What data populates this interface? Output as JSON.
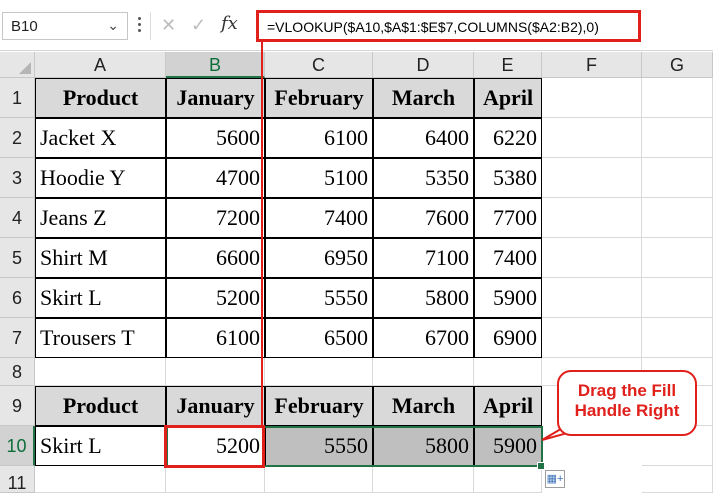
{
  "formula_bar": {
    "name_box": "B10",
    "formula": "=VLOOKUP($A10,$A$1:$E$7,COLUMNS($A2:B2),0)",
    "icons": [
      "chevron-down-icon",
      "more-icon",
      "cancel-icon",
      "enter-icon",
      "function-icon"
    ],
    "fx_label": "fx"
  },
  "columns": [
    "A",
    "B",
    "C",
    "D",
    "E",
    "F",
    "G"
  ],
  "rows": [
    "1",
    "2",
    "3",
    "4",
    "5",
    "6",
    "7",
    "8",
    "9",
    "10",
    "11"
  ],
  "table1": {
    "headers": [
      "Product",
      "January",
      "February",
      "March",
      "April"
    ],
    "rows": [
      [
        "Jacket X",
        "5600",
        "6100",
        "6400",
        "6220"
      ],
      [
        "Hoodie Y",
        "4700",
        "5100",
        "5350",
        "5380"
      ],
      [
        "Jeans Z",
        "7200",
        "7400",
        "7600",
        "7700"
      ],
      [
        "Shirt M",
        "6600",
        "6950",
        "7100",
        "7400"
      ],
      [
        "Skirt L",
        "5200",
        "5550",
        "5800",
        "5900"
      ],
      [
        "Trousers T",
        "6100",
        "6500",
        "6700",
        "6900"
      ]
    ]
  },
  "table2": {
    "headers": [
      "Product",
      "January",
      "February",
      "March",
      "April"
    ],
    "row": [
      "Skirt L",
      "5200",
      "5550",
      "5800",
      "5900"
    ]
  },
  "callout": {
    "line1": "Drag the Fill",
    "line2": "Handle Right"
  },
  "colors": {
    "highlight_red": "#e0201b",
    "selection_green": "#217346",
    "header_fill": "#d9d9d9",
    "fill_range": "#bfbfbf"
  }
}
